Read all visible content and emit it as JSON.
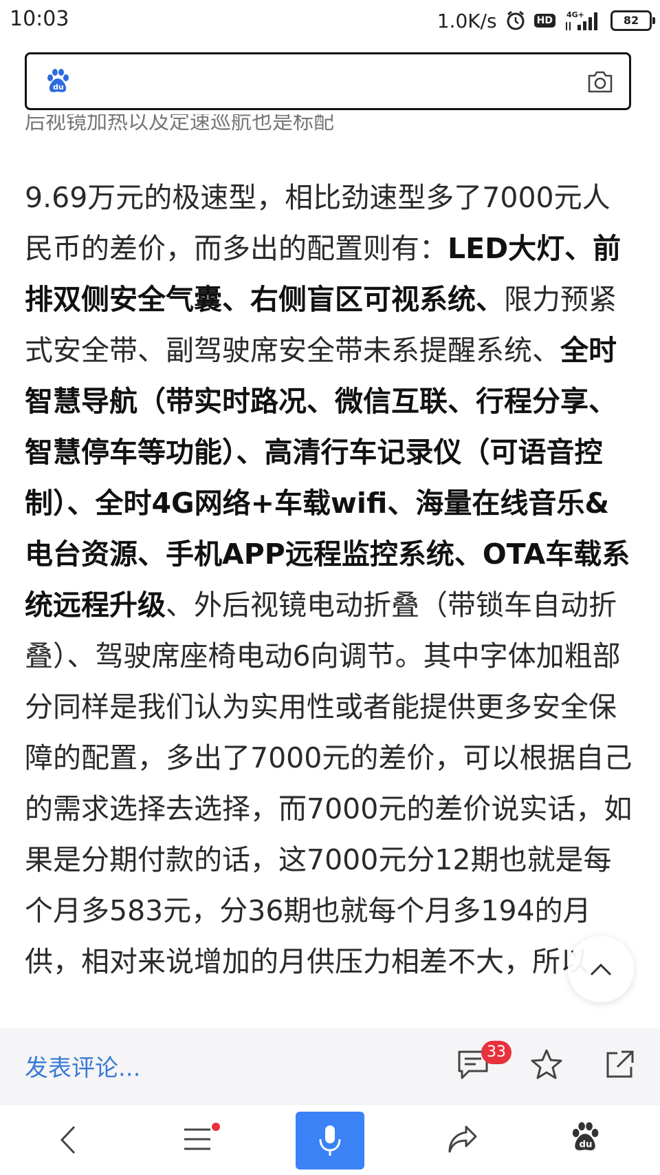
{
  "status": {
    "time": "10:03",
    "net_speed": "1.0K/s",
    "hd_label": "HD",
    "network_label": "4G+",
    "battery": "82"
  },
  "search": {
    "logo_icon": "baidu-paw-icon",
    "camera_icon": "camera-icon"
  },
  "article": {
    "cut_line": "后视镜加热以及定速巡航也是标配",
    "paragraph": [
      {
        "text": "9.69万元的极速型，相比劲速型多了7000元人民币的差价，而多出的配置则有：",
        "bold": false
      },
      {
        "text": "LED大灯、前排双侧安全气囊、右侧盲区可视系统、",
        "bold": true
      },
      {
        "text": "限力预紧式安全带、副驾驶席安全带未系提醒系统、",
        "bold": false
      },
      {
        "text": "全时智慧导航（带实时路况、微信互联、行程分享、智慧停车等功能）、高清行车记录仪（可语音控制）、全时4G网络+车载wifi、海量在线音乐&电台资源、手机APP远程监控系统、OTA车载系统远程升级",
        "bold": true
      },
      {
        "text": "、外后视镜电动折叠（带锁车自动折叠）、驾驶席座椅电动6向调节。其中字体加粗部分同样是我们认为实用性或者能提供更多安全保障的配置，多出了7000元的差价，可以根据自己的需求选择去选择，而7000元的差价说实话，如果是分期付款的话，这7000元分12期也就是每个月多583元，分36期也就每个月多194的月供，相对来说增加的月供压力相差不大，所以",
        "bold": false
      }
    ]
  },
  "comment_bar": {
    "placeholder": "发表评论...",
    "comment_count": "33"
  },
  "colors": {
    "accent_blue": "#3b82f6",
    "link_blue": "#3a7bd5",
    "badge_red": "#e8323e"
  }
}
